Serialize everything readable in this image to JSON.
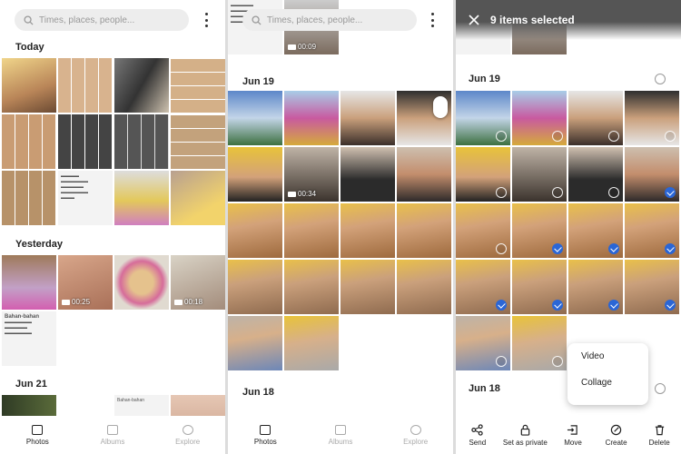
{
  "search": {
    "placeholder": "Times, places, people..."
  },
  "sections": {
    "today": "Today",
    "yesterday": "Yesterday",
    "jun21": "Jun 21",
    "jun19": "Jun 19",
    "jun18": "Jun 18"
  },
  "durations": {
    "d1": "00:25",
    "d2": "00:18",
    "d3": "00:09",
    "d4": "00:34"
  },
  "doc_text": {
    "title": "Bahan-bahan",
    "tag": "Bahan-bahan"
  },
  "nav": {
    "photos": "Photos",
    "albums": "Albums",
    "explore": "Explore"
  },
  "selection": {
    "title": "9 items selected"
  },
  "actions": {
    "send": "Send",
    "private": "Set as private",
    "move": "Move",
    "create": "Create",
    "delete": "Delete"
  },
  "menu": {
    "video": "Video",
    "collage": "Collage"
  },
  "colors": {
    "accent": "#2a66d6",
    "thumb_warm": "#c9a27c",
    "thumb_yellow": "#e8c33a",
    "thumb_sky": "#7aa6d6"
  }
}
